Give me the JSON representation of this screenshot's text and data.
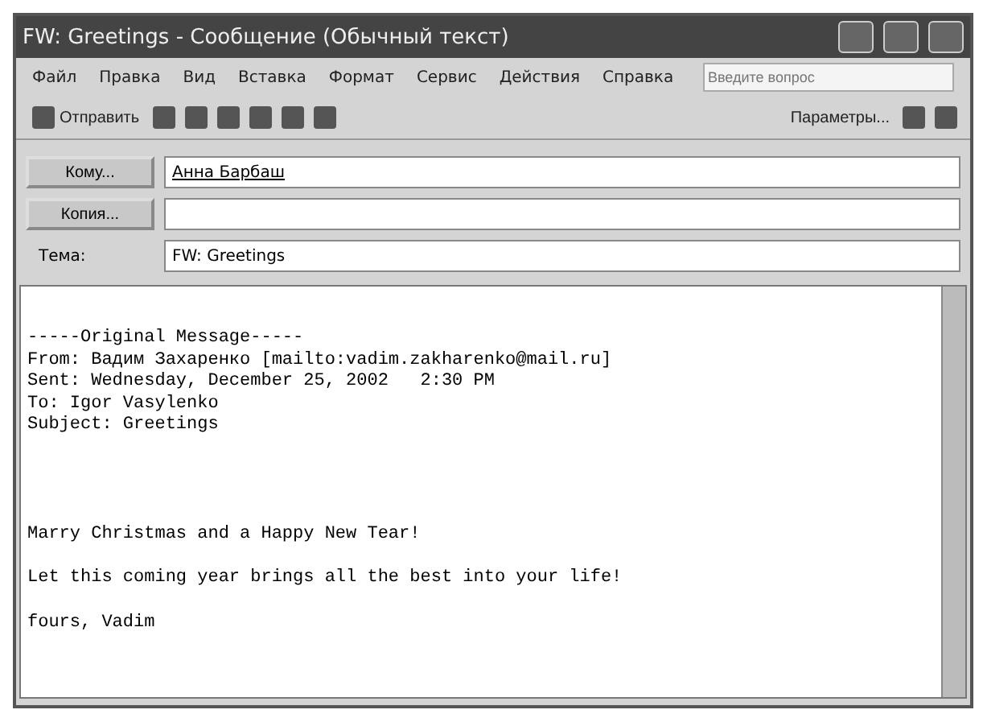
{
  "window": {
    "title": "FW: Greetings - Сообщение (Обычный текст)"
  },
  "menu": [
    "Файл",
    "Правка",
    "Вид",
    "Вставка",
    "Формат",
    "Сервис",
    "Действия",
    "Справка"
  ],
  "help_search": {
    "placeholder": "Введите вопрос"
  },
  "toolbar": {
    "send": "Отправить",
    "options": "Параметры..."
  },
  "fields": [
    {
      "kind": "button",
      "label": "Кому...",
      "value": "Анна Барбаш"
    },
    {
      "kind": "button",
      "label": "Копия..."
    },
    {
      "kind": "label",
      "label": "Тема:",
      "value": "FW: Greetings"
    }
  ],
  "body": [
    [
      "-----Original Message-----",
      "From: Вадим Захаренко [mailto:vadim.zakharenko@mail.ru]",
      "Sent: Wednesday, December 25, 2002   2:30 PM",
      "To: Igor Vasylenko",
      "Subject: Greetings"
    ],
    [
      "Marry Christmas and a Happy New Tear!"
    ],
    [
      "Let this coming year brings all the best into your life!"
    ],
    [
      "fours, Vadim"
    ]
  ]
}
